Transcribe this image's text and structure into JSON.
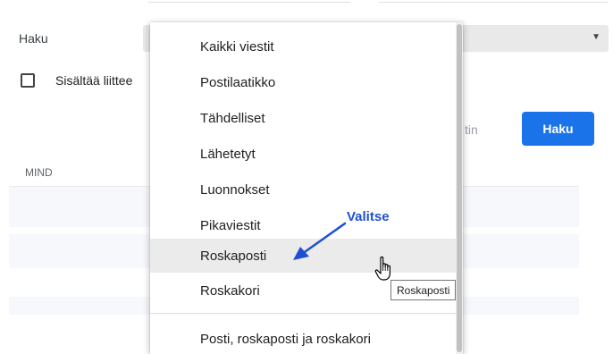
{
  "search_form": {
    "label": "Haku",
    "attachment_label": "Sisältää liittee",
    "muted_button_fragment": "tin",
    "submit_label": "Haku"
  },
  "mail_list": {
    "row_fragment": "MIND"
  },
  "dropdown": {
    "items": [
      {
        "label": "Kaikki viestit"
      },
      {
        "label": "Postilaatikko"
      },
      {
        "label": "Tähdelliset"
      },
      {
        "label": "Lähetetyt"
      },
      {
        "label": "Luonnokset"
      },
      {
        "label": "Pikaviestit"
      },
      {
        "label": "Roskaposti"
      },
      {
        "label": "Roskakori"
      },
      {
        "label": "Posti, roskaposti ja roskakori"
      }
    ],
    "hovered_index": 6
  },
  "annotation": {
    "text": "Valitse",
    "color": "#1f4fd1"
  },
  "tooltip": {
    "text": "Roskaposti"
  },
  "colors": {
    "primary": "#1a73e8",
    "hover": "#ebebeb"
  }
}
